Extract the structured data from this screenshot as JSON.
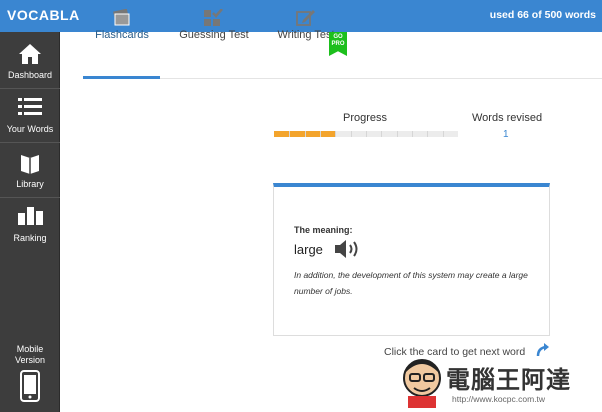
{
  "app": {
    "brand": "VOCABLA",
    "usage": "used 66 of 500 words",
    "accent": "#3a86d1"
  },
  "sidebar": {
    "items": [
      {
        "label": "Dashboard",
        "icon": "home-icon"
      },
      {
        "label": "Your Words",
        "icon": "list-icon"
      },
      {
        "label": "Library",
        "icon": "books-icon"
      },
      {
        "label": "Ranking",
        "icon": "bar-chart-icon"
      }
    ],
    "mobile": {
      "line1": "Mobile",
      "line2": "Version",
      "icon": "smartphone-icon"
    }
  },
  "tabs": [
    {
      "label": "Flashcards",
      "icon": "cards-icon",
      "active": true
    },
    {
      "label": "Guessing Test",
      "icon": "grid-check-icon",
      "active": false
    },
    {
      "label": "Writing Test",
      "icon": "edit-icon",
      "active": false
    }
  ],
  "gopro": {
    "line1": "GO",
    "line2": "PRO"
  },
  "progress": {
    "label": "Progress",
    "value": 0.33,
    "fill_color": "#f3a42c"
  },
  "words_revised": {
    "label": "Words revised",
    "value": "1"
  },
  "card": {
    "meaning_label": "The meaning:",
    "word": "large",
    "example": "In addition, the development of this system may create a large number of jobs."
  },
  "hint": "Click the card to get next word",
  "watermark": {
    "text": "電腦王阿達",
    "url": "http://www.kocpc.com.tw"
  }
}
